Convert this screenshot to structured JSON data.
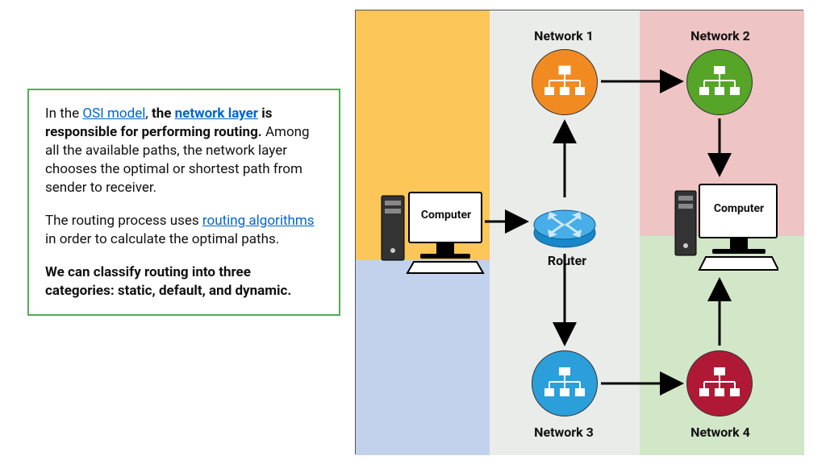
{
  "text_panel": {
    "p1_prefix": "In the ",
    "link_osi": "OSI model",
    "p1_mid": ", ",
    "p1_bold1a": "the ",
    "link_network_layer": "network layer",
    "p1_bold1b": " is responsible for performing routing.",
    "p1_tail": " Among all the available paths, the network layer chooses the optimal or shortest path from sender to receiver.",
    "p2_prefix": "The routing process uses ",
    "link_routing_alg": "routing algorithms",
    "p2_tail": " in order to calculate the optimal paths.",
    "p3_bold": "We can classify routing into three categories: static, default, and dynamic."
  },
  "diagram": {
    "labels": {
      "net1": "Network 1",
      "net2": "Network 2",
      "net3": "Network 3",
      "net4": "Network 4",
      "computer_left": "Computer",
      "computer_right": "Computer",
      "router": "Router"
    },
    "colors": {
      "net1": "#f18b21",
      "net2": "#56a528",
      "net3": "#2b9fda",
      "net4": "#b01935"
    }
  }
}
